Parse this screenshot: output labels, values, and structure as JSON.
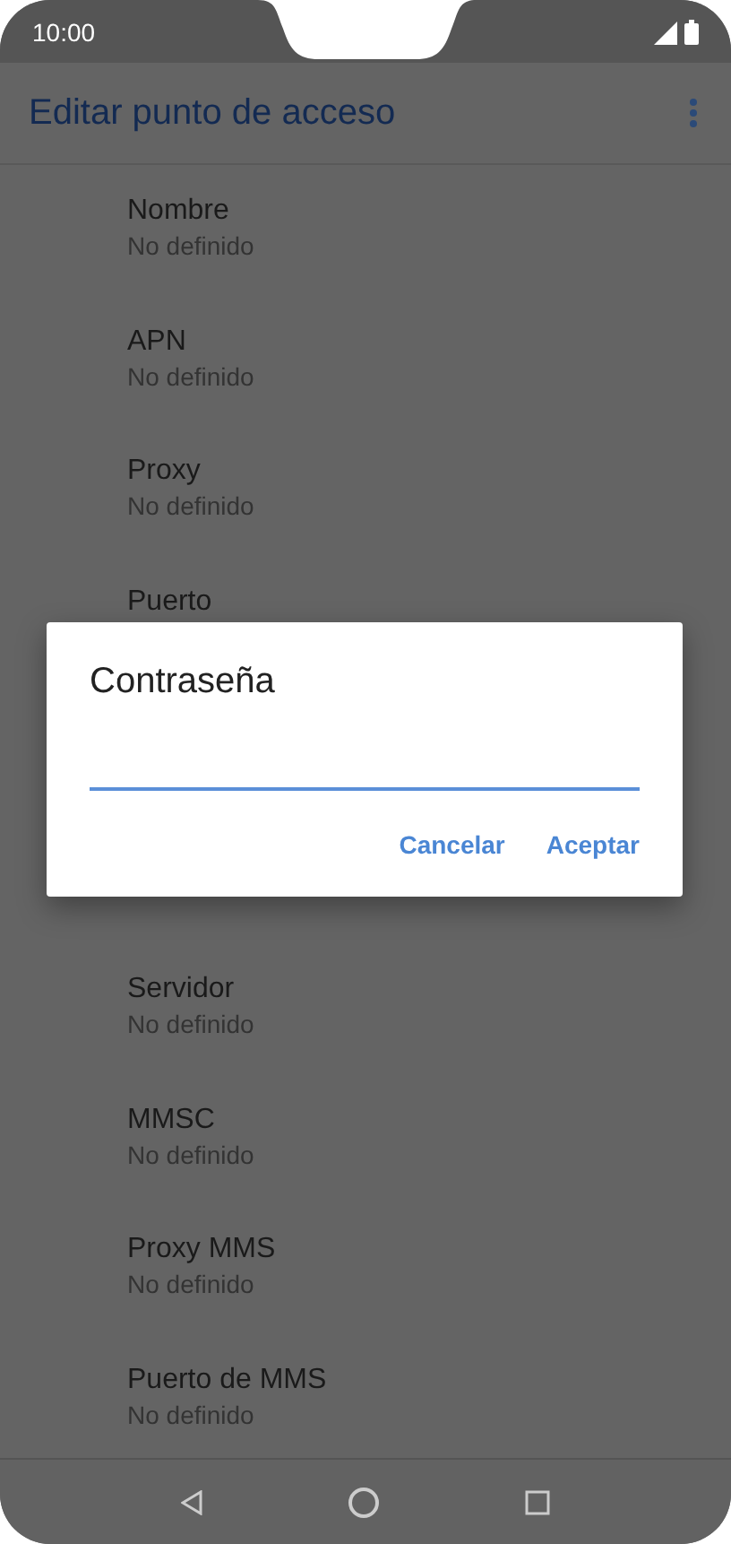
{
  "status_bar": {
    "time": "10:00"
  },
  "app_bar": {
    "title": "Editar punto de acceso"
  },
  "settings_above": [
    {
      "label": "Nombre",
      "value": "No definido"
    },
    {
      "label": "APN",
      "value": "No definido"
    },
    {
      "label": "Proxy",
      "value": "No definido"
    },
    {
      "label": "Puerto"
    }
  ],
  "dialog": {
    "title": "Contraseña",
    "buttons": [
      "Cancelar",
      "Aceptar"
    ]
  },
  "settings_below": [
    {
      "label": "Servidor",
      "value": "No definido"
    },
    {
      "label": "MMSC",
      "value": "No definido"
    },
    {
      "label": "Proxy MMS",
      "value": "No definido"
    },
    {
      "label": "Puerto de MMS",
      "value": "No definido"
    }
  ]
}
